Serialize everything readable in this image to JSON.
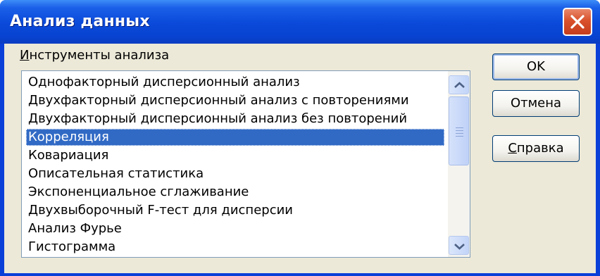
{
  "window": {
    "title": "Анализ данных"
  },
  "tools": {
    "label_accel": "И",
    "label_rest": "нструменты анализа",
    "items": [
      "Однофакторный дисперсионный анализ",
      "Двухфакторный дисперсионный анализ с повторениями",
      "Двухфакторный дисперсионный анализ без повторений",
      "Корреляция",
      "Ковариация",
      "Описательная статистика",
      "Экспоненциальное сглаживание",
      "Двухвыборочный F-тест для дисперсии",
      "Анализ Фурье",
      "Гистограмма"
    ],
    "selected_item": "Корреляция"
  },
  "buttons": {
    "ok": "OK",
    "cancel": "Отмена",
    "help_accel": "С",
    "help_rest": "правка"
  },
  "icons": {
    "close": "close-icon",
    "scroll_up": "chevron-up-icon",
    "scroll_down": "chevron-down-icon"
  },
  "colors": {
    "title_bar": "#0a49d9",
    "selection": "#316ac5",
    "close_button": "#d9512c",
    "dialog_face": "#ece9d8"
  }
}
